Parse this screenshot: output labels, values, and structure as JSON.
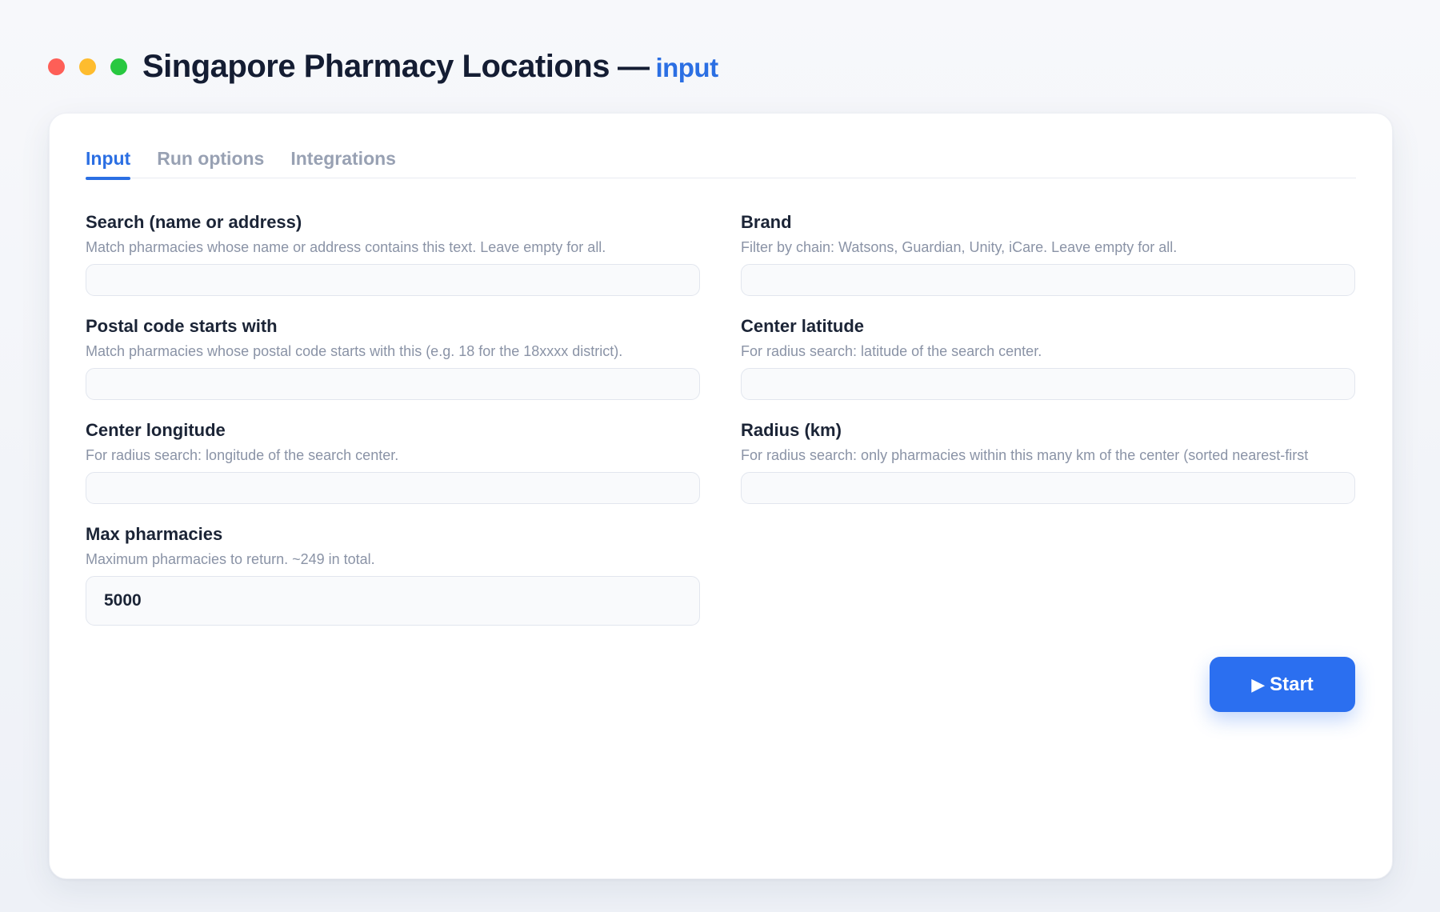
{
  "window": {
    "title": "Singapore Pharmacy Locations",
    "separator": "—",
    "subtitle": "input",
    "controls": [
      "close",
      "minimize",
      "maximize"
    ]
  },
  "tabs": [
    {
      "label": "Input",
      "active": true
    },
    {
      "label": "Run options",
      "active": false
    },
    {
      "label": "Integrations",
      "active": false
    }
  ],
  "fields": {
    "search": {
      "label": "Search (name or address)",
      "help": "Match pharmacies whose name or address contains this text. Leave empty for all.",
      "value": ""
    },
    "brand": {
      "label": "Brand",
      "help": "Filter by chain: Watsons, Guardian, Unity, iCare. Leave empty for all.",
      "value": ""
    },
    "postal": {
      "label": "Postal code starts with",
      "help": "Match pharmacies whose postal code starts with this (e.g. 18 for the 18xxxx district).",
      "value": ""
    },
    "latitude": {
      "label": "Center latitude",
      "help": "For radius search: latitude of the search center.",
      "value": ""
    },
    "longitude": {
      "label": "Center longitude",
      "help": "For radius search: longitude of the search center.",
      "value": ""
    },
    "radius": {
      "label": "Radius (km)",
      "help": "For radius search: only pharmacies within this many km of the center (sorted nearest-first",
      "value": ""
    },
    "max": {
      "label": "Max pharmacies",
      "help": "Maximum pharmacies to return. ~249 in total.",
      "value": "5000"
    }
  },
  "start_button": {
    "icon": "play-icon",
    "glyph": "▶",
    "label": "Start"
  },
  "colors": {
    "accent": "#2b6fe3",
    "button": "#2b6ff0",
    "close": "#fe5f57",
    "minimize": "#febc2e",
    "maximize": "#28c840"
  }
}
